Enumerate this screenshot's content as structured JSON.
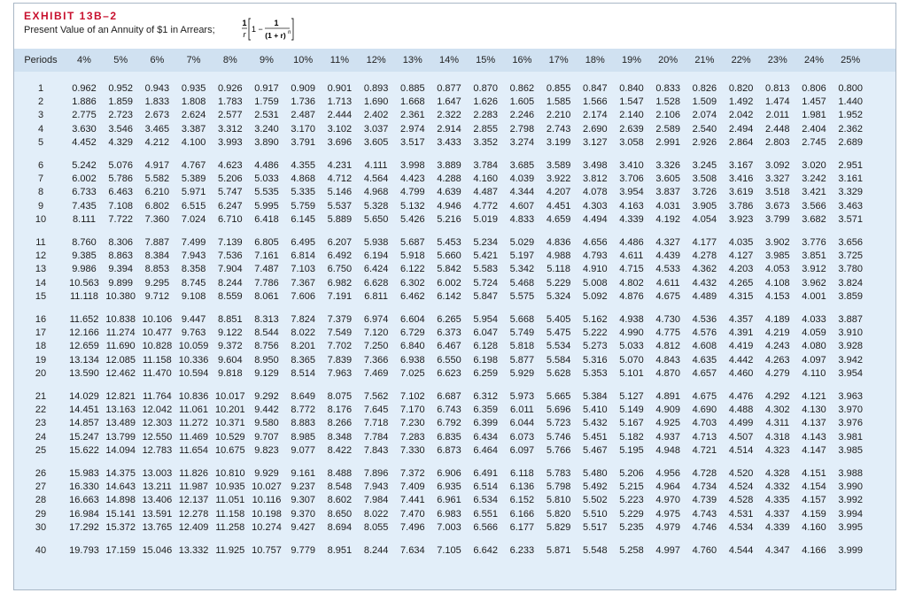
{
  "exhibit": "EXHIBIT 13B–2",
  "subtitle": "Present Value of an Annuity of $1 in Arrears;",
  "formula": {
    "num": "1",
    "den": "r",
    "bracket_lead": "1 −",
    "inner_num": "1",
    "inner_den": "(1 + r)",
    "exponent": "n"
  },
  "columns": [
    "Periods",
    "4%",
    "5%",
    "6%",
    "7%",
    "8%",
    "9%",
    "10%",
    "11%",
    "12%",
    "13%",
    "14%",
    "15%",
    "16%",
    "17%",
    "18%",
    "19%",
    "20%",
    "21%",
    "22%",
    "23%",
    "24%",
    "25%"
  ],
  "rows": [
    {
      "p": "1",
      "v": [
        "0.962",
        "0.952",
        "0.943",
        "0.935",
        "0.926",
        "0.917",
        "0.909",
        "0.901",
        "0.893",
        "0.885",
        "0.877",
        "0.870",
        "0.862",
        "0.855",
        "0.847",
        "0.840",
        "0.833",
        "0.826",
        "0.820",
        "0.813",
        "0.806",
        "0.800"
      ]
    },
    {
      "p": "2",
      "v": [
        "1.886",
        "1.859",
        "1.833",
        "1.808",
        "1.783",
        "1.759",
        "1.736",
        "1.713",
        "1.690",
        "1.668",
        "1.647",
        "1.626",
        "1.605",
        "1.585",
        "1.566",
        "1.547",
        "1.528",
        "1.509",
        "1.492",
        "1.474",
        "1.457",
        "1.440"
      ]
    },
    {
      "p": "3",
      "v": [
        "2.775",
        "2.723",
        "2.673",
        "2.624",
        "2.577",
        "2.531",
        "2.487",
        "2.444",
        "2.402",
        "2.361",
        "2.322",
        "2.283",
        "2.246",
        "2.210",
        "2.174",
        "2.140",
        "2.106",
        "2.074",
        "2.042",
        "2.011",
        "1.981",
        "1.952"
      ]
    },
    {
      "p": "4",
      "v": [
        "3.630",
        "3.546",
        "3.465",
        "3.387",
        "3.312",
        "3.240",
        "3.170",
        "3.102",
        "3.037",
        "2.974",
        "2.914",
        "2.855",
        "2.798",
        "2.743",
        "2.690",
        "2.639",
        "2.589",
        "2.540",
        "2.494",
        "2.448",
        "2.404",
        "2.362"
      ]
    },
    {
      "p": "5",
      "v": [
        "4.452",
        "4.329",
        "4.212",
        "4.100",
        "3.993",
        "3.890",
        "3.791",
        "3.696",
        "3.605",
        "3.517",
        "3.433",
        "3.352",
        "3.274",
        "3.199",
        "3.127",
        "3.058",
        "2.991",
        "2.926",
        "2.864",
        "2.803",
        "2.745",
        "2.689"
      ]
    },
    {
      "p": "6",
      "v": [
        "5.242",
        "5.076",
        "4.917",
        "4.767",
        "4.623",
        "4.486",
        "4.355",
        "4.231",
        "4.111",
        "3.998",
        "3.889",
        "3.784",
        "3.685",
        "3.589",
        "3.498",
        "3.410",
        "3.326",
        "3.245",
        "3.167",
        "3.092",
        "3.020",
        "2.951"
      ]
    },
    {
      "p": "7",
      "v": [
        "6.002",
        "5.786",
        "5.582",
        "5.389",
        "5.206",
        "5.033",
        "4.868",
        "4.712",
        "4.564",
        "4.423",
        "4.288",
        "4.160",
        "4.039",
        "3.922",
        "3.812",
        "3.706",
        "3.605",
        "3.508",
        "3.416",
        "3.327",
        "3.242",
        "3.161"
      ]
    },
    {
      "p": "8",
      "v": [
        "6.733",
        "6.463",
        "6.210",
        "5.971",
        "5.747",
        "5.535",
        "5.335",
        "5.146",
        "4.968",
        "4.799",
        "4.639",
        "4.487",
        "4.344",
        "4.207",
        "4.078",
        "3.954",
        "3.837",
        "3.726",
        "3.619",
        "3.518",
        "3.421",
        "3.329"
      ]
    },
    {
      "p": "9",
      "v": [
        "7.435",
        "7.108",
        "6.802",
        "6.515",
        "6.247",
        "5.995",
        "5.759",
        "5.537",
        "5.328",
        "5.132",
        "4.946",
        "4.772",
        "4.607",
        "4.451",
        "4.303",
        "4.163",
        "4.031",
        "3.905",
        "3.786",
        "3.673",
        "3.566",
        "3.463"
      ]
    },
    {
      "p": "10",
      "v": [
        "8.111",
        "7.722",
        "7.360",
        "7.024",
        "6.710",
        "6.418",
        "6.145",
        "5.889",
        "5.650",
        "5.426",
        "5.216",
        "5.019",
        "4.833",
        "4.659",
        "4.494",
        "4.339",
        "4.192",
        "4.054",
        "3.923",
        "3.799",
        "3.682",
        "3.571"
      ]
    },
    {
      "p": "11",
      "v": [
        "8.760",
        "8.306",
        "7.887",
        "7.499",
        "7.139",
        "6.805",
        "6.495",
        "6.207",
        "5.938",
        "5.687",
        "5.453",
        "5.234",
        "5.029",
        "4.836",
        "4.656",
        "4.486",
        "4.327",
        "4.177",
        "4.035",
        "3.902",
        "3.776",
        "3.656"
      ]
    },
    {
      "p": "12",
      "v": [
        "9.385",
        "8.863",
        "8.384",
        "7.943",
        "7.536",
        "7.161",
        "6.814",
        "6.492",
        "6.194",
        "5.918",
        "5.660",
        "5.421",
        "5.197",
        "4.988",
        "4.793",
        "4.611",
        "4.439",
        "4.278",
        "4.127",
        "3.985",
        "3.851",
        "3.725"
      ]
    },
    {
      "p": "13",
      "v": [
        "9.986",
        "9.394",
        "8.853",
        "8.358",
        "7.904",
        "7.487",
        "7.103",
        "6.750",
        "6.424",
        "6.122",
        "5.842",
        "5.583",
        "5.342",
        "5.118",
        "4.910",
        "4.715",
        "4.533",
        "4.362",
        "4.203",
        "4.053",
        "3.912",
        "3.780"
      ]
    },
    {
      "p": "14",
      "v": [
        "10.563",
        "9.899",
        "9.295",
        "8.745",
        "8.244",
        "7.786",
        "7.367",
        "6.982",
        "6.628",
        "6.302",
        "6.002",
        "5.724",
        "5.468",
        "5.229",
        "5.008",
        "4.802",
        "4.611",
        "4.432",
        "4.265",
        "4.108",
        "3.962",
        "3.824"
      ]
    },
    {
      "p": "15",
      "v": [
        "11.118",
        "10.380",
        "9.712",
        "9.108",
        "8.559",
        "8.061",
        "7.606",
        "7.191",
        "6.811",
        "6.462",
        "6.142",
        "5.847",
        "5.575",
        "5.324",
        "5.092",
        "4.876",
        "4.675",
        "4.489",
        "4.315",
        "4.153",
        "4.001",
        "3.859"
      ]
    },
    {
      "p": "16",
      "v": [
        "11.652",
        "10.838",
        "10.106",
        "9.447",
        "8.851",
        "8.313",
        "7.824",
        "7.379",
        "6.974",
        "6.604",
        "6.265",
        "5.954",
        "5.668",
        "5.405",
        "5.162",
        "4.938",
        "4.730",
        "4.536",
        "4.357",
        "4.189",
        "4.033",
        "3.887"
      ]
    },
    {
      "p": "17",
      "v": [
        "12.166",
        "11.274",
        "10.477",
        "9.763",
        "9.122",
        "8.544",
        "8.022",
        "7.549",
        "7.120",
        "6.729",
        "6.373",
        "6.047",
        "5.749",
        "5.475",
        "5.222",
        "4.990",
        "4.775",
        "4.576",
        "4.391",
        "4.219",
        "4.059",
        "3.910"
      ]
    },
    {
      "p": "18",
      "v": [
        "12.659",
        "11.690",
        "10.828",
        "10.059",
        "9.372",
        "8.756",
        "8.201",
        "7.702",
        "7.250",
        "6.840",
        "6.467",
        "6.128",
        "5.818",
        "5.534",
        "5.273",
        "5.033",
        "4.812",
        "4.608",
        "4.419",
        "4.243",
        "4.080",
        "3.928"
      ]
    },
    {
      "p": "19",
      "v": [
        "13.134",
        "12.085",
        "11.158",
        "10.336",
        "9.604",
        "8.950",
        "8.365",
        "7.839",
        "7.366",
        "6.938",
        "6.550",
        "6.198",
        "5.877",
        "5.584",
        "5.316",
        "5.070",
        "4.843",
        "4.635",
        "4.442",
        "4.263",
        "4.097",
        "3.942"
      ]
    },
    {
      "p": "20",
      "v": [
        "13.590",
        "12.462",
        "11.470",
        "10.594",
        "9.818",
        "9.129",
        "8.514",
        "7.963",
        "7.469",
        "7.025",
        "6.623",
        "6.259",
        "5.929",
        "5.628",
        "5.353",
        "5.101",
        "4.870",
        "4.657",
        "4.460",
        "4.279",
        "4.110",
        "3.954"
      ]
    },
    {
      "p": "21",
      "v": [
        "14.029",
        "12.821",
        "11.764",
        "10.836",
        "10.017",
        "9.292",
        "8.649",
        "8.075",
        "7.562",
        "7.102",
        "6.687",
        "6.312",
        "5.973",
        "5.665",
        "5.384",
        "5.127",
        "4.891",
        "4.675",
        "4.476",
        "4.292",
        "4.121",
        "3.963"
      ]
    },
    {
      "p": "22",
      "v": [
        "14.451",
        "13.163",
        "12.042",
        "11.061",
        "10.201",
        "9.442",
        "8.772",
        "8.176",
        "7.645",
        "7.170",
        "6.743",
        "6.359",
        "6.011",
        "5.696",
        "5.410",
        "5.149",
        "4.909",
        "4.690",
        "4.488",
        "4.302",
        "4.130",
        "3.970"
      ]
    },
    {
      "p": "23",
      "v": [
        "14.857",
        "13.489",
        "12.303",
        "11.272",
        "10.371",
        "9.580",
        "8.883",
        "8.266",
        "7.718",
        "7.230",
        "6.792",
        "6.399",
        "6.044",
        "5.723",
        "5.432",
        "5.167",
        "4.925",
        "4.703",
        "4.499",
        "4.311",
        "4.137",
        "3.976"
      ]
    },
    {
      "p": "24",
      "v": [
        "15.247",
        "13.799",
        "12.550",
        "11.469",
        "10.529",
        "9.707",
        "8.985",
        "8.348",
        "7.784",
        "7.283",
        "6.835",
        "6.434",
        "6.073",
        "5.746",
        "5.451",
        "5.182",
        "4.937",
        "4.713",
        "4.507",
        "4.318",
        "4.143",
        "3.981"
      ]
    },
    {
      "p": "25",
      "v": [
        "15.622",
        "14.094",
        "12.783",
        "11.654",
        "10.675",
        "9.823",
        "9.077",
        "8.422",
        "7.843",
        "7.330",
        "6.873",
        "6.464",
        "6.097",
        "5.766",
        "5.467",
        "5.195",
        "4.948",
        "4.721",
        "4.514",
        "4.323",
        "4.147",
        "3.985"
      ]
    },
    {
      "p": "26",
      "v": [
        "15.983",
        "14.375",
        "13.003",
        "11.826",
        "10.810",
        "9.929",
        "9.161",
        "8.488",
        "7.896",
        "7.372",
        "6.906",
        "6.491",
        "6.118",
        "5.783",
        "5.480",
        "5.206",
        "4.956",
        "4.728",
        "4.520",
        "4.328",
        "4.151",
        "3.988"
      ]
    },
    {
      "p": "27",
      "v": [
        "16.330",
        "14.643",
        "13.211",
        "11.987",
        "10.935",
        "10.027",
        "9.237",
        "8.548",
        "7.943",
        "7.409",
        "6.935",
        "6.514",
        "6.136",
        "5.798",
        "5.492",
        "5.215",
        "4.964",
        "4.734",
        "4.524",
        "4.332",
        "4.154",
        "3.990"
      ]
    },
    {
      "p": "28",
      "v": [
        "16.663",
        "14.898",
        "13.406",
        "12.137",
        "11.051",
        "10.116",
        "9.307",
        "8.602",
        "7.984",
        "7.441",
        "6.961",
        "6.534",
        "6.152",
        "5.810",
        "5.502",
        "5.223",
        "4.970",
        "4.739",
        "4.528",
        "4.335",
        "4.157",
        "3.992"
      ]
    },
    {
      "p": "29",
      "v": [
        "16.984",
        "15.141",
        "13.591",
        "12.278",
        "11.158",
        "10.198",
        "9.370",
        "8.650",
        "8.022",
        "7.470",
        "6.983",
        "6.551",
        "6.166",
        "5.820",
        "5.510",
        "5.229",
        "4.975",
        "4.743",
        "4.531",
        "4.337",
        "4.159",
        "3.994"
      ]
    },
    {
      "p": "30",
      "v": [
        "17.292",
        "15.372",
        "13.765",
        "12.409",
        "11.258",
        "10.274",
        "9.427",
        "8.694",
        "8.055",
        "7.496",
        "7.003",
        "6.566",
        "6.177",
        "5.829",
        "5.517",
        "5.235",
        "4.979",
        "4.746",
        "4.534",
        "4.339",
        "4.160",
        "3.995"
      ]
    },
    {
      "p": "40",
      "v": [
        "19.793",
        "17.159",
        "15.046",
        "13.332",
        "11.925",
        "10.757",
        "9.779",
        "8.951",
        "8.244",
        "7.634",
        "7.105",
        "6.642",
        "6.233",
        "5.871",
        "5.548",
        "5.258",
        "4.997",
        "4.760",
        "4.544",
        "4.347",
        "4.166",
        "3.999"
      ]
    }
  ]
}
